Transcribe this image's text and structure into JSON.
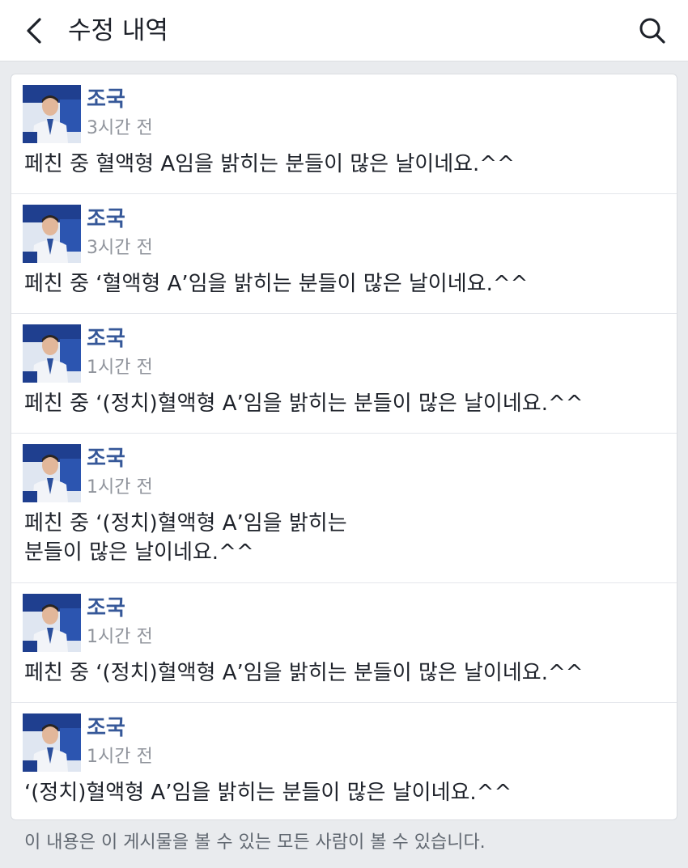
{
  "header": {
    "title": "수정 내역",
    "back_icon": "chevron-left-icon",
    "search_icon": "search-icon"
  },
  "entries": [
    {
      "author": "조국",
      "time": "3시간 전",
      "text_lines": [
        "페친 중 혈액형 A임을 밝히는 분들이 많은 날이네요.^^"
      ]
    },
    {
      "author": "조국",
      "time": "3시간 전",
      "text_lines": [
        "페친 중 ‘혈액형 A’임을 밝히는 분들이 많은 날이네요.^^"
      ]
    },
    {
      "author": "조국",
      "time": "1시간 전",
      "text_lines": [
        "페친 중 ‘(정치)혈액형 A’임을 밝히는 분들이 많은 날이네요.^^"
      ]
    },
    {
      "author": "조국",
      "time": "1시간 전",
      "text_lines": [
        "페친 중 ‘(정치)혈액형 A’임을 밝히는",
        "분들이 많은 날이네요.^^"
      ]
    },
    {
      "author": "조국",
      "time": "1시간 전",
      "text_lines": [
        "페친 중 ‘(정치)혈액형 A’임을 밝히는 분들이 많은 날이네요.^^"
      ]
    },
    {
      "author": "조국",
      "time": "1시간 전",
      "text_lines": [
        "‘(정치)혈액형 A’임을 밝히는 분들이 많은 날이네요.^^"
      ]
    }
  ],
  "footer": {
    "note": "이 내용은 이 게시물을 볼 수 있는 모든 사람이 볼 수 있습니다."
  },
  "colors": {
    "author_link": "#365899",
    "timestamp": "#90949c",
    "page_background": "#e9ebee",
    "avatar_banner": "#1f3f8f"
  }
}
